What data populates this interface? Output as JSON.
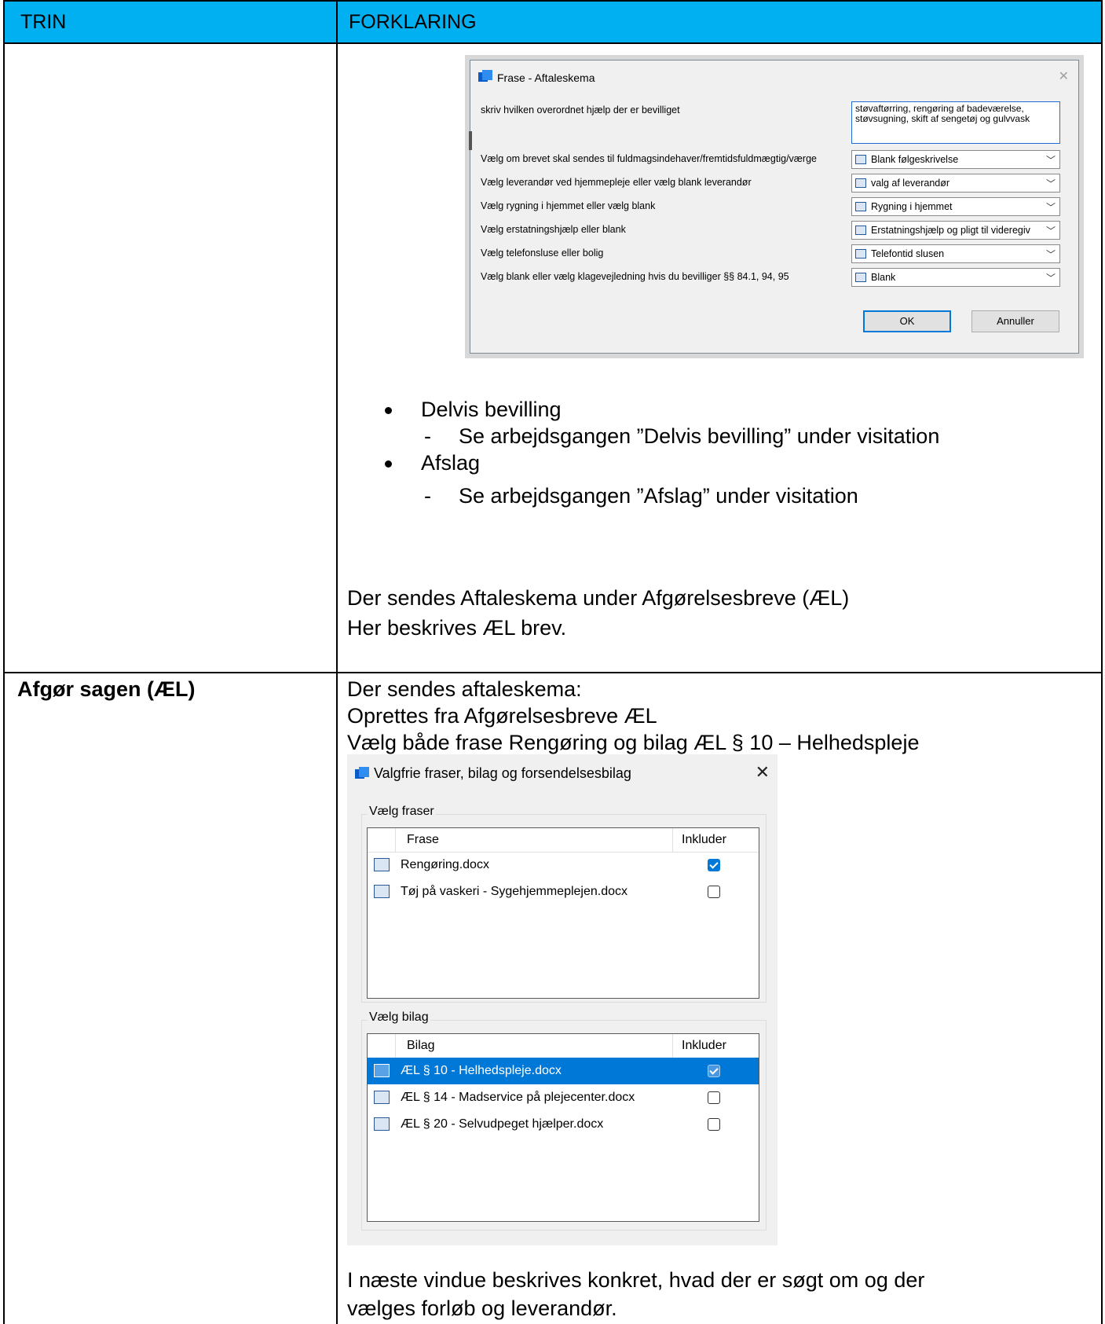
{
  "table": {
    "header_col1": "TRIN",
    "header_col2": "FORKLARING"
  },
  "dialog1": {
    "title": "Frase - Aftaleskema",
    "close": "✕",
    "rows": [
      {
        "label": "skriv hvilken overordnet hjælp der er bevilliget"
      },
      {
        "label": "Vælg om brevet skal sendes til fuldmagsindehaver/fremtidsfuldmægtig/værge",
        "value": "Blank følgeskrivelse"
      },
      {
        "label": "Vælg leverandør ved hjemmepleje eller vælg blank leverandør",
        "value": "valg af leverandør"
      },
      {
        "label": "Vælg rygning i hjemmet eller vælg blank",
        "value": "Rygning i hjemmet"
      },
      {
        "label": "Vælg erstatningshjælp eller blank",
        "value": "Erstatningshjælp og pligt til videregiv"
      },
      {
        "label": "Vælg  telefonsluse eller bolig",
        "value": "Telefontid slusen"
      },
      {
        "label": "Vælg blank eller vælg klagevejledning hvis du bevilliger §§ 84.1, 94, 95",
        "value": "Blank"
      }
    ],
    "textarea_line1": "støvaftørring, rengøring af badeværelse,",
    "textarea_line2": "støvsugning, skift af sengetøj og gulvvask",
    "ok": "OK",
    "cancel": "Annuller"
  },
  "bullets": [
    {
      "text": "Delvis bevilling",
      "sub": "Se arbejdsgangen ”Delvis bevilling” under visitation"
    },
    {
      "text": "Afslag",
      "sub": "Se arbejdsgangen ”Afslag” under visitation"
    }
  ],
  "dash": "-",
  "para1_line1": "Der sendes Aftaleskema under Afgørelsesbreve (ÆL)",
  "para1_line2": "Her beskrives ÆL brev.",
  "step2_title": "Afgør sagen (ÆL)",
  "step2_line1": "Der sendes aftaleskema:",
  "step2_line2": "Oprettes fra Afgørelsesbreve ÆL",
  "step2_line3": "Vælg både frase Rengøring og bilag ÆL § 10 – Helhedspleje",
  "dialog2": {
    "title": "Valgfrie fraser, bilag og forsendelsesbilag",
    "close": "✕",
    "group1_label": "Vælg fraser",
    "group1_col1": "Frase",
    "group1_col2": "Inkluder",
    "fraser": [
      {
        "name": "Rengøring.docx",
        "checked": true
      },
      {
        "name": "Tøj på vaskeri - Sygehjemmeplejen.docx",
        "checked": false
      }
    ],
    "group2_label": "Vælg bilag",
    "group2_col1": "Bilag",
    "group2_col2": "Inkluder",
    "bilag": [
      {
        "name": "ÆL § 10 - Helhedspleje.docx",
        "checked": true,
        "selected": true
      },
      {
        "name": "ÆL § 14 - Madservice på plejecenter.docx",
        "checked": false
      },
      {
        "name": "ÆL § 20 - Selvudpeget hjælper.docx",
        "checked": false
      }
    ]
  },
  "footer_line1": "I næste vindue beskrives konkret, hvad der er søgt om og der",
  "footer_line2": "vælges forløb og leverandør."
}
